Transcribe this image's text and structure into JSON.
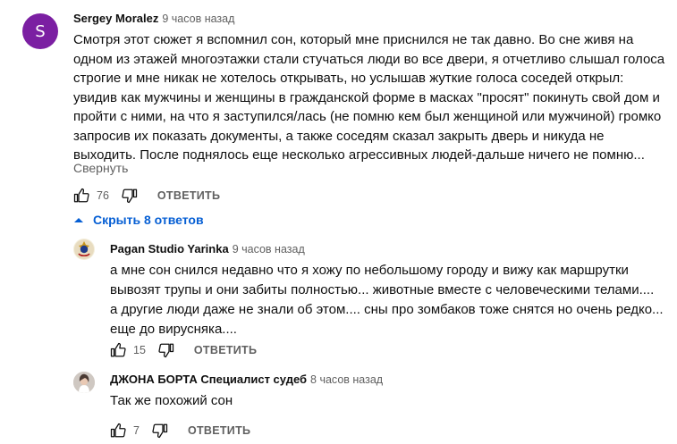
{
  "comment": {
    "avatar_letter": "S",
    "avatar_color": "#7b1fa2",
    "author": "Sergey Moralez",
    "time": "9 часов назад",
    "text_lines": [
      "Смотря этот сюжет я вспомнил сон, который мне приснился не так давно. Во сне живя на",
      "одном из этажей многоэтажки стали стучаться люди во все двери, я отчетливо слышал голоса",
      "строгие и мне никак не хотелось открывать, но услышав жуткие голоса соседей открыл:",
      "увидив как мужчины и женщины в гражданской форме в масках \"просят\" покинуть свой дом и",
      "пройти с ними, на что я заступился/лась (не помню кем был женщиной или мужчиной) громко",
      "запросив их показать документы, а также соседям  сказал закрыть дверь и никуда не",
      "выходить. После поднялось еще несколько агрессивных людей-дальше ничего не помню..."
    ],
    "collapse_label": "Свернуть",
    "likes": "76",
    "reply_label": "ОТВЕТИТЬ"
  },
  "replies_toggle": {
    "label": "Скрыть 8 ответов",
    "accent": "#065fd4"
  },
  "replies": [
    {
      "author": "Pagan Studio Yarinka",
      "time": "9 часов назад",
      "text_lines": [
        "а мне сон снился недавно что я хожу по небольшому городу и вижу как маршрутки",
        "вывозят трупы и они забиты полностью... животные вместе с человеческими телами....",
        " а другие люди даже не знали об этом....  сны про зомбаков тоже снятся но очень редко...",
        "еще до вирусняка...."
      ],
      "likes": "15",
      "reply_label": "ОТВЕТИТЬ",
      "avatar_icon": "emblem-icon"
    },
    {
      "author": "ДЖОНА БОРТА Специалист судеб",
      "time": "8 часов назад",
      "text_lines": [
        "Так же похожий сон"
      ],
      "likes": "7",
      "reply_label": "ОТВЕТИТЬ",
      "avatar_icon": "photo-avatar-icon"
    }
  ],
  "icons": {
    "like": "thumb-up-icon",
    "dislike": "thumb-down-icon",
    "toggle": "chevron-up-icon"
  },
  "colors": {
    "text": "#0f0f0f",
    "secondary": "#606060"
  }
}
